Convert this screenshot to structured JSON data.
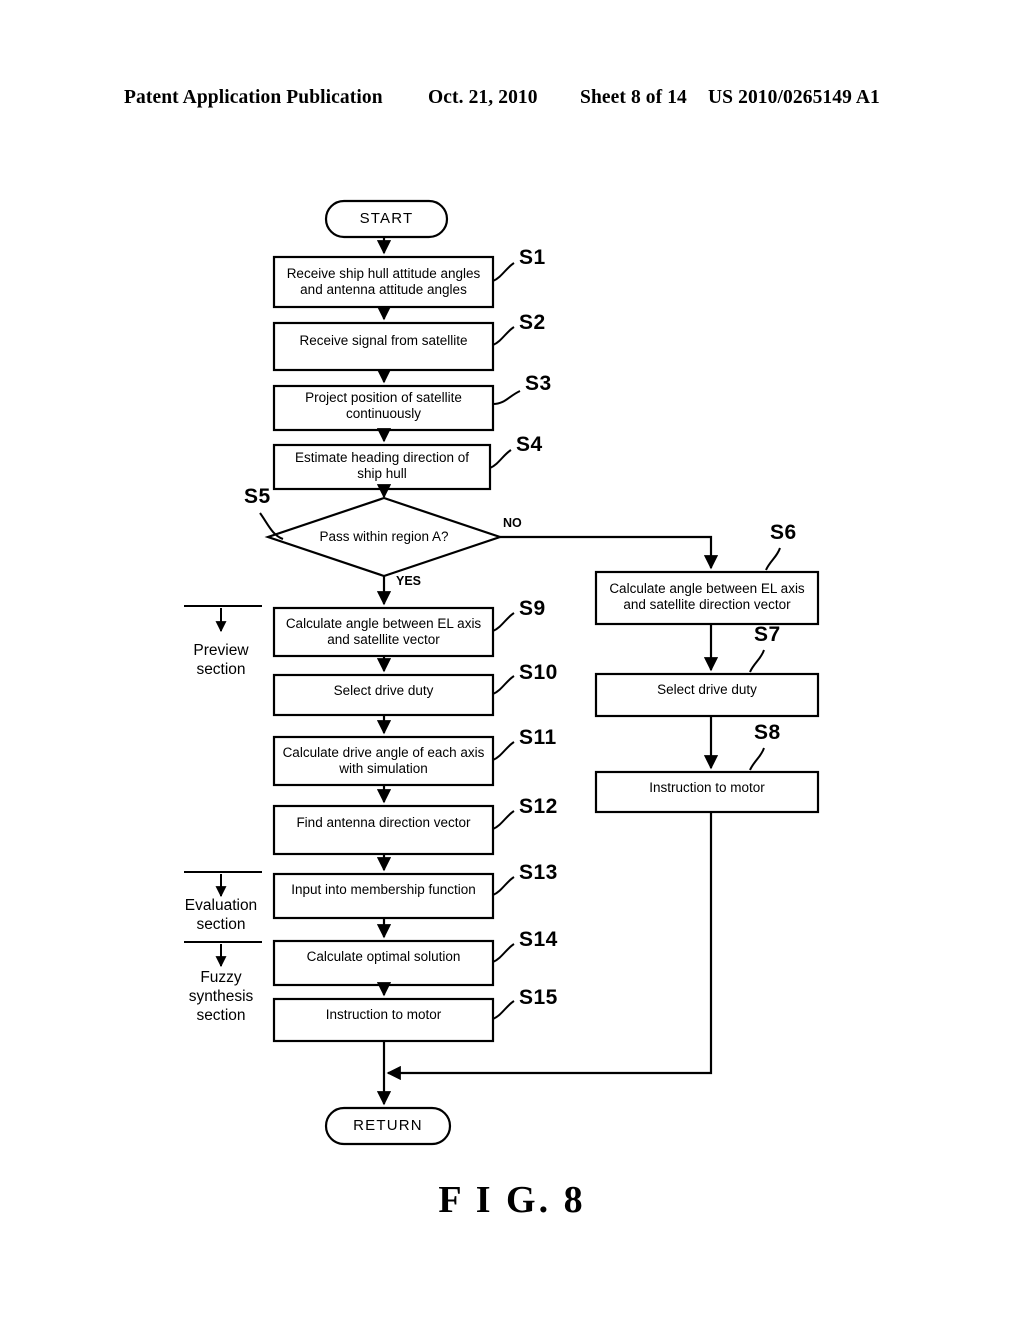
{
  "header": {
    "publication": "Patent Application Publication",
    "date": "Oct. 21, 2010",
    "sheet": "Sheet 8 of 14",
    "number": "US 2010/0265149 A1"
  },
  "figure": {
    "caption": "F I G. 8"
  },
  "colors": {
    "stroke": "#000000",
    "background": "#ffffff",
    "text": "#000000"
  },
  "flowchart": {
    "terminators": [
      {
        "id": "start",
        "label": "START"
      },
      {
        "id": "return",
        "label": "RETURN"
      }
    ],
    "decision": {
      "id": "S5",
      "step": "S5",
      "label": "Pass within region A?",
      "yes_label": "YES",
      "no_label": "NO"
    },
    "main_steps": [
      {
        "step": "S1",
        "label": "Receive ship hull attitude angles\nand antenna attitude angles"
      },
      {
        "step": "S2",
        "label": "Receive signal from satellite"
      },
      {
        "step": "S3",
        "label": "Project position of satellite\ncontinuously"
      },
      {
        "step": "S4",
        "label": "Estimate heading direction of\nship hull"
      }
    ],
    "yes_branch_steps": [
      {
        "step": "S9",
        "label": "Calculate angle between EL axis\nand satellite vector"
      },
      {
        "step": "S10",
        "label": "Select drive duty"
      },
      {
        "step": "S11",
        "label": "Calculate drive angle of each axis\nwith simulation"
      },
      {
        "step": "S12",
        "label": "Find antenna direction vector"
      },
      {
        "step": "S13",
        "label": "Input into membership function"
      },
      {
        "step": "S14",
        "label": "Calculate optimal solution"
      },
      {
        "step": "S15",
        "label": "Instruction to motor"
      }
    ],
    "no_branch_steps": [
      {
        "step": "S6",
        "label": "Calculate angle between EL axis\nand satellite direction vector"
      },
      {
        "step": "S7",
        "label": "Select drive duty"
      },
      {
        "step": "S8",
        "label": "Instruction to motor"
      }
    ],
    "sections": [
      {
        "id": "preview",
        "label": "Preview\nsection"
      },
      {
        "id": "evaluation",
        "label": "Evaluation\nsection"
      },
      {
        "id": "fuzzy",
        "label": "Fuzzy\nsynthesis\nsection"
      }
    ]
  }
}
